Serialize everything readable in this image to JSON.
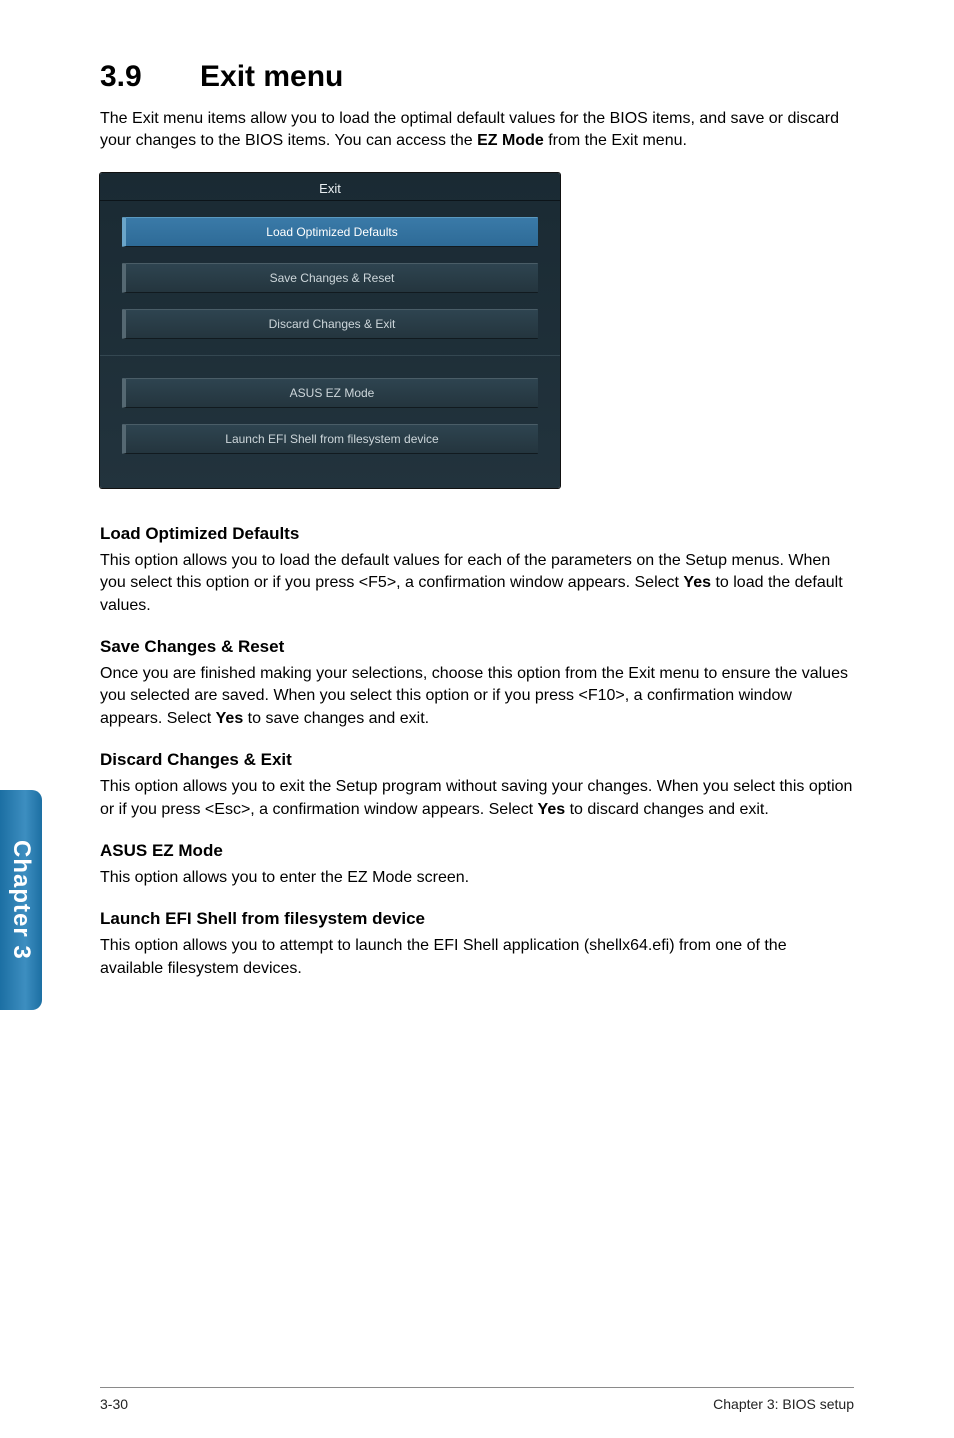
{
  "section": {
    "number": "3.9",
    "title": "Exit menu"
  },
  "intro": {
    "pre": "The Exit menu items allow you to load the optimal default values for the BIOS items, and save or discard your changes to the BIOS items. You can access the ",
    "bold": "EZ Mode",
    "post": " from the Exit menu."
  },
  "screenshot": {
    "header": "Exit",
    "items": [
      "Load Optimized Defaults",
      "Save Changes & Reset",
      "Discard Changes & Exit",
      "ASUS EZ Mode",
      "Launch EFI Shell from filesystem device"
    ]
  },
  "blocks": {
    "lod": {
      "heading": "Load Optimized Defaults",
      "p_pre": "This option allows you to load the default values for each of the parameters on the Setup menus. When you select this option or if you press <F5>, a confirmation window appears. Select ",
      "p_bold": "Yes",
      "p_post": " to load the default values."
    },
    "scr": {
      "heading": "Save Changes & Reset",
      "p_pre": "Once you are finished making your selections, choose this option from the Exit menu to ensure the values you selected are saved. When you select this option or if you press <F10>, a confirmation window appears. Select ",
      "p_bold": "Yes",
      "p_post": " to save changes and exit."
    },
    "dce": {
      "heading": "Discard Changes & Exit",
      "p_pre": "This option allows you to exit the Setup program without saving your changes. When you select this option or if you press <Esc>, a confirmation window appears. Select ",
      "p_bold": "Yes",
      "p_post": " to discard changes and exit."
    },
    "ez": {
      "heading": "ASUS EZ Mode",
      "p": "This option allows you to enter the EZ Mode screen."
    },
    "efi": {
      "heading": "Launch EFI Shell from filesystem device",
      "p": "This option allows you to attempt to launch the EFI Shell application (shellx64.efi) from one of the available filesystem devices."
    }
  },
  "side_tab": "Chapter 3",
  "footer": {
    "left": "3-30",
    "right": "Chapter 3: BIOS setup"
  }
}
